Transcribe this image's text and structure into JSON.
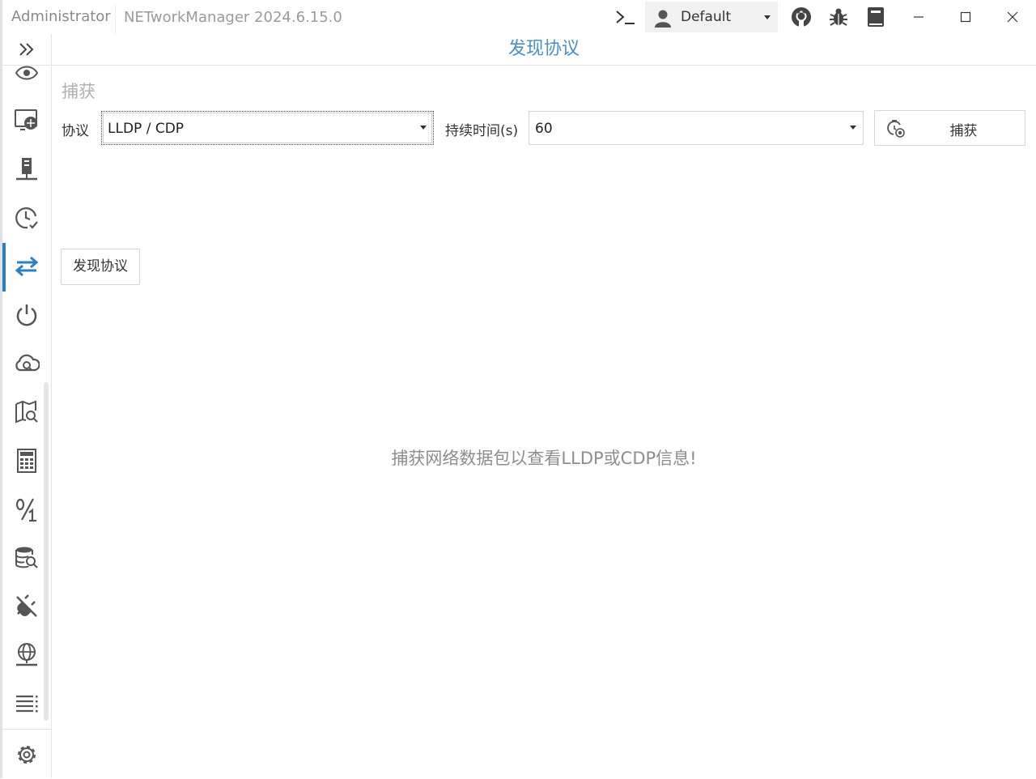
{
  "titlebar": {
    "user": "Administrator",
    "app_title": "NETworkManager 2024.6.15.0",
    "profile": "Default"
  },
  "header": {
    "title": "发现协议"
  },
  "capture": {
    "section_title": "捕获",
    "protocol_label": "协议",
    "protocol_value": "LLDP / CDP",
    "duration_label": "持续时间(s)",
    "duration_value": "60",
    "capture_button": "捕获"
  },
  "actions": {
    "discover_button": "发现协议"
  },
  "hint": "捕获网络数据包以查看LLDP或CDP信息!",
  "sidebar": {
    "active_index": 4,
    "items": [
      "eye-icon",
      "remote-desktop-icon",
      "server-icon",
      "clock-check-icon",
      "arrows-exchange-icon",
      "power-icon",
      "cloud-search-icon",
      "map-search-icon",
      "calculator-icon",
      "fraction-icon",
      "database-search-icon",
      "plug-off-icon",
      "web-icon",
      "list-icon"
    ]
  },
  "colors": {
    "accent": "#2b7fc5",
    "header": "#4a90c8",
    "hint": "#8d8d8d"
  }
}
